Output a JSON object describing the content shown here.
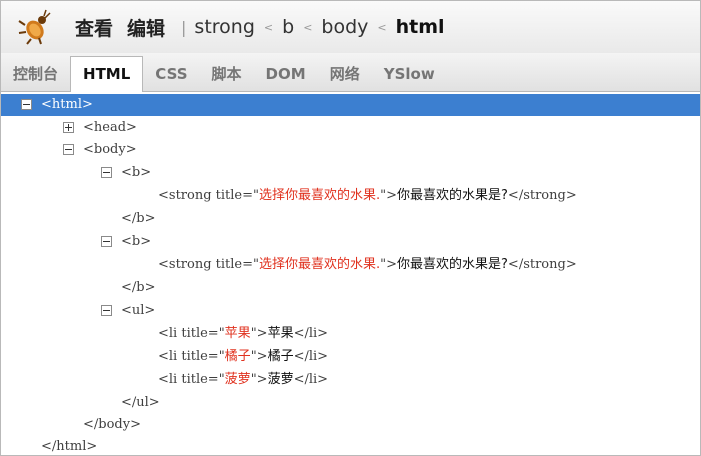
{
  "toolbar": {
    "icon": "firebug-icon",
    "menu_view": "查看",
    "menu_edit": "编辑",
    "breadcrumbs": [
      "strong",
      "b",
      "body",
      "html"
    ]
  },
  "tabs": [
    "控制台",
    "HTML",
    "CSS",
    "脚本",
    "DOM",
    "网络",
    "YSlow"
  ],
  "active_tab": "HTML",
  "tree": {
    "html_open": "<html>",
    "head": "<head>",
    "body_open": "<body>",
    "b_open": "<b>",
    "b_close": "</b>",
    "strong_open_prefix": "<strong title=\"",
    "strong_title_1": "选择你最喜欢的水果.",
    "strong_title_2": "选择你最喜欢的水果.",
    "strong_open_suffix": "\">",
    "strong_text": "你最喜欢的水果是?",
    "strong_close": "</strong>",
    "ul_open": "<ul>",
    "li_prefix": "<li title=\"",
    "li_suffix": "\">",
    "li_close": "</li>",
    "items": [
      {
        "title": "苹果",
        "text": "苹果"
      },
      {
        "title": "橘子",
        "text": "橘子"
      },
      {
        "title": "菠萝",
        "text": "菠萝"
      }
    ],
    "ul_close": "</ul>",
    "body_close": "</body>",
    "html_close": "</html>"
  },
  "colors": {
    "selection": "#3c7fd0",
    "attr_value": "#e0321f"
  }
}
